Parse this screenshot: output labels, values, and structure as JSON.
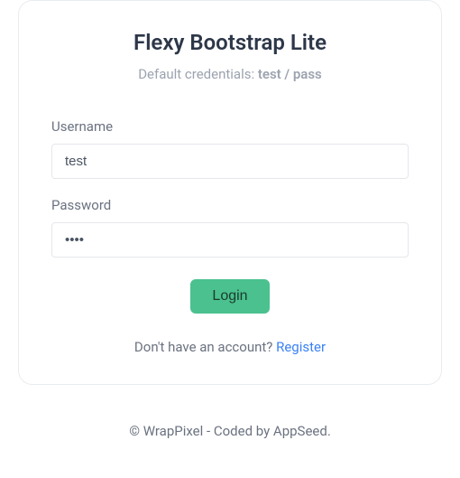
{
  "card": {
    "title": "Flexy Bootstrap Lite",
    "subtitle_prefix": "Default credentials: ",
    "subtitle_strong": "test / pass"
  },
  "form": {
    "username_label": "Username",
    "username_value": "test",
    "password_label": "Password",
    "password_value": "pass",
    "login_button": "Login"
  },
  "register": {
    "prompt": "Don't have an account? ",
    "link": "Register"
  },
  "footer": {
    "text": "© WrapPixel - Coded by AppSeed."
  }
}
